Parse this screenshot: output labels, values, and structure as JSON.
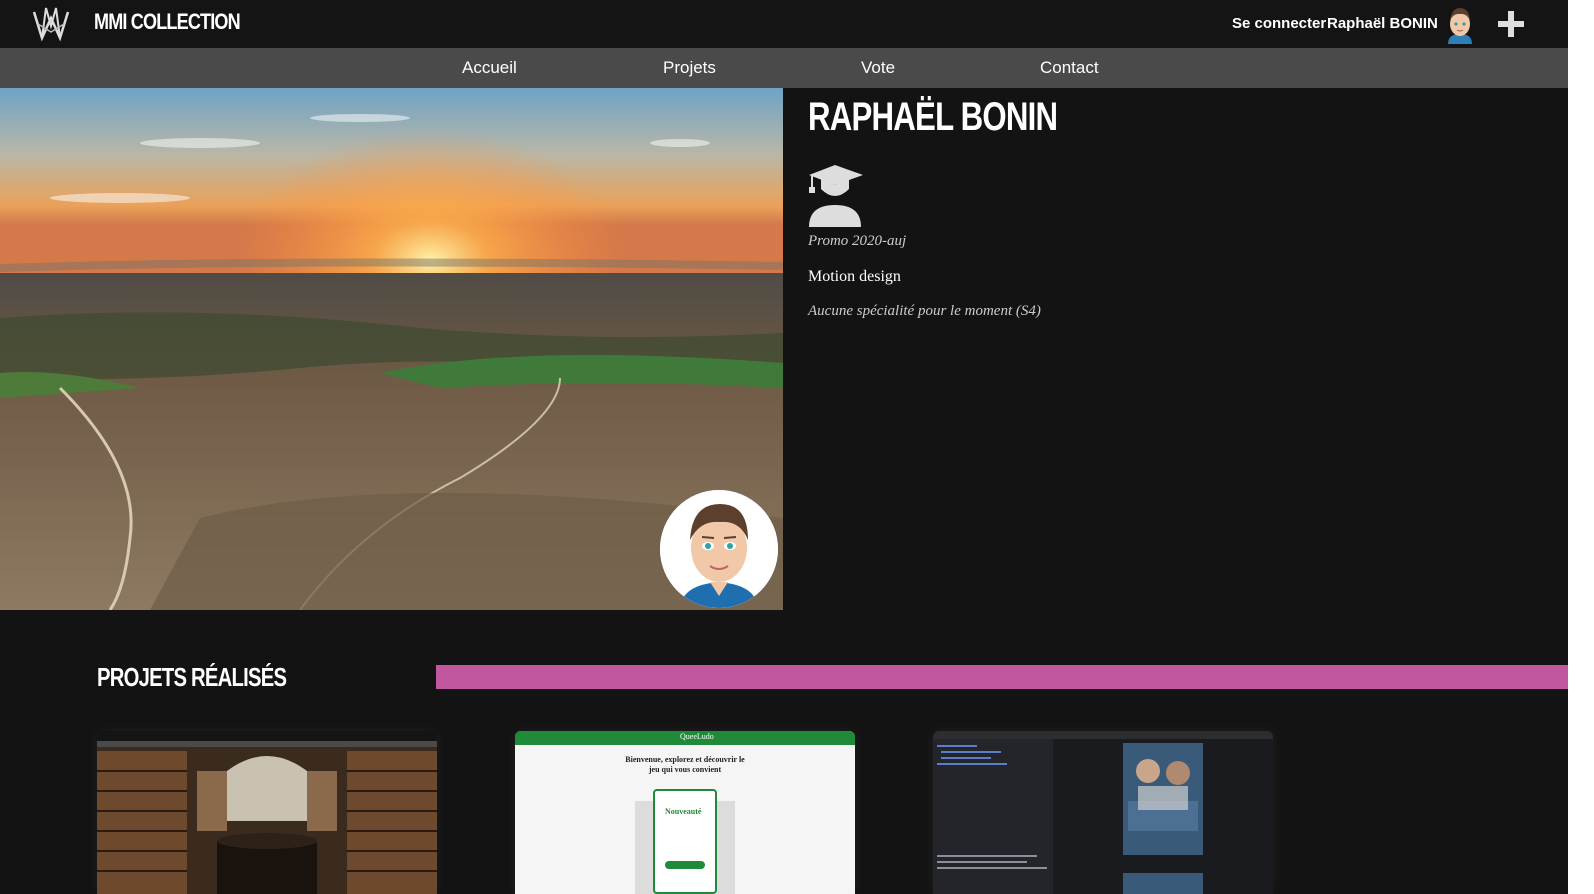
{
  "header": {
    "brand": "MMI COLLECTION",
    "login_label": "Se connecter",
    "user_name": "Raphaël BONIN"
  },
  "nav": {
    "items": [
      "Accueil",
      "Projets",
      "Vote",
      "Contact"
    ]
  },
  "profile": {
    "name": "RAPHAËL BONIN",
    "promo": "Promo 2020-auj",
    "domain": "Motion design",
    "speciality": "Aucune spécialité pour le moment (S4)"
  },
  "projects": {
    "title": "PROJETS RÉALISÉS",
    "cards": [
      {
        "thumbnail": "library-site"
      },
      {
        "thumbnail": "queeludo-site",
        "header": "QueeLudo",
        "welcome": "Bienvenue, explorez et découvrir le jeu qui vous convient",
        "card_title": "Nouveauté"
      },
      {
        "thumbnail": "code-editor"
      }
    ]
  },
  "colors": {
    "accent_pink": "#c0579f",
    "nav_bg": "#4a4a4a",
    "page_bg": "#131313",
    "queeludo_green": "#1f8a3a"
  }
}
